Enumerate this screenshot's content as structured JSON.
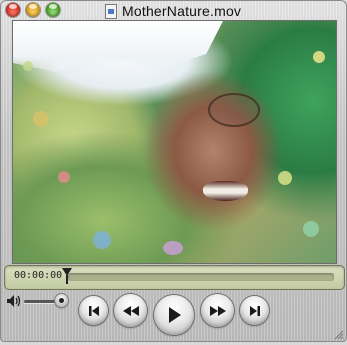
{
  "window": {
    "title": "MotherNature.mov",
    "controls": [
      "close",
      "minimize",
      "zoom"
    ]
  },
  "player": {
    "timecode": "00:00:00",
    "progress_fraction": 0.0,
    "volume_fraction": 0.8,
    "buttons": {
      "go_to_start": "skip-to-start-icon",
      "rewind": "rewind-icon",
      "play": "play-icon",
      "fast_forward": "fast-forward-icon",
      "go_to_end": "skip-to-end-icon"
    }
  },
  "colors": {
    "scrubber_bg": "#c3cba3",
    "close": "#d0291a",
    "minimize": "#d99a12",
    "zoom": "#3f9a22"
  }
}
